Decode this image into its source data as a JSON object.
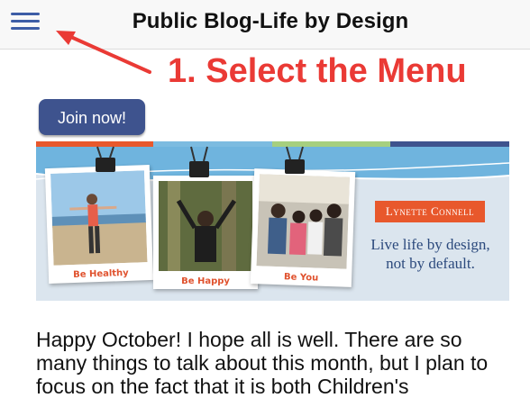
{
  "header": {
    "title": "Public Blog-Life by Design",
    "menu_icon": "hamburger-menu-icon"
  },
  "annotation": {
    "text": "1. Select the Menu",
    "color": "#ea3a35"
  },
  "join_button": {
    "label": "Join now!",
    "color": "#3e538e"
  },
  "banner": {
    "brand": "Lynette Connell",
    "slogan_line1": "Live life by design,",
    "slogan_line2": "not by default.",
    "photos": [
      {
        "caption": "Be Healthy"
      },
      {
        "caption": "Be Happy"
      },
      {
        "caption": "Be You"
      }
    ],
    "stripe_colors": [
      "#e8582c",
      "#7cbbe0",
      "#a6cf7f",
      "#3e538e"
    ]
  },
  "article": {
    "text": "Happy October! I hope all is well. There are so many things to talk about this month, but I plan to focus on the fact that it is both Children's"
  }
}
